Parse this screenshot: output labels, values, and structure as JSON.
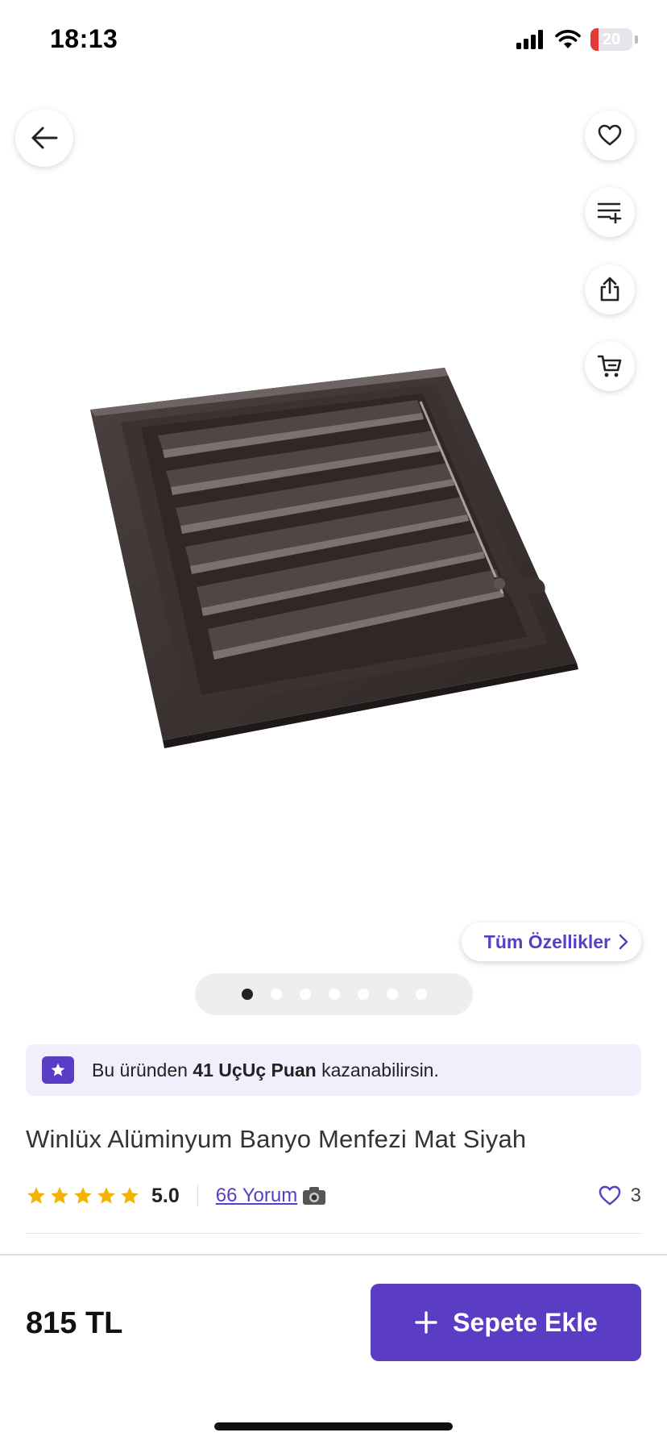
{
  "status_bar": {
    "time": "18:13",
    "battery_level": "20",
    "battery_color": "#e53935"
  },
  "icons": {
    "back": "arrow-left-icon",
    "favorite": "heart-icon",
    "compare": "list-add-icon",
    "share": "share-icon",
    "cart": "cart-icon"
  },
  "product": {
    "features_link": "Tüm Özellikler",
    "image_count": 7,
    "active_image": 1,
    "points": {
      "prefix": "Bu üründen",
      "bold": "41 UçUç Puan",
      "suffix": "kazanabilirsin."
    },
    "title": "Winlüx Alüminyum Banyo Menfezi Mat Siyah",
    "rating": {
      "stars": 5,
      "value": "5.0",
      "reviews": "66 Yorum"
    },
    "favorites": "3"
  },
  "bottom_bar": {
    "price": "815 TL",
    "add_to_cart": "Sepete Ekle"
  },
  "colors": {
    "brand": "#5b3cc4",
    "star": "#f5b301",
    "banner_bg": "#f1effb"
  }
}
